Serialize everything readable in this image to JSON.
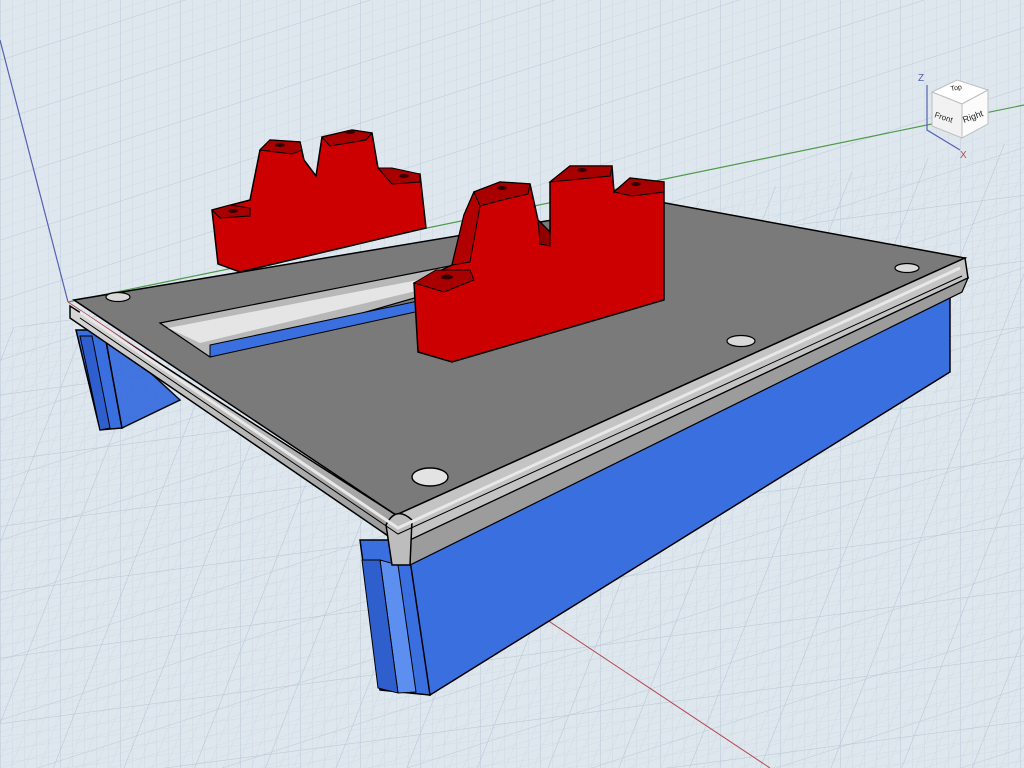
{
  "viewport": {
    "background_color": "#dfe7ee",
    "grid_color": "#c3d0dc",
    "axis_colors": {
      "x": "#b5484c",
      "y": "#4e9a4a",
      "z": "#5560b0"
    }
  },
  "model": {
    "base_color": "#7a7a7a",
    "legs_color": "#3a6fe0",
    "brackets_color": "#cc0000"
  },
  "view_cube": {
    "faces": {
      "top": "Top",
      "front": "Front",
      "right": "Right"
    },
    "axes": {
      "z": "Z",
      "x": "X"
    }
  }
}
